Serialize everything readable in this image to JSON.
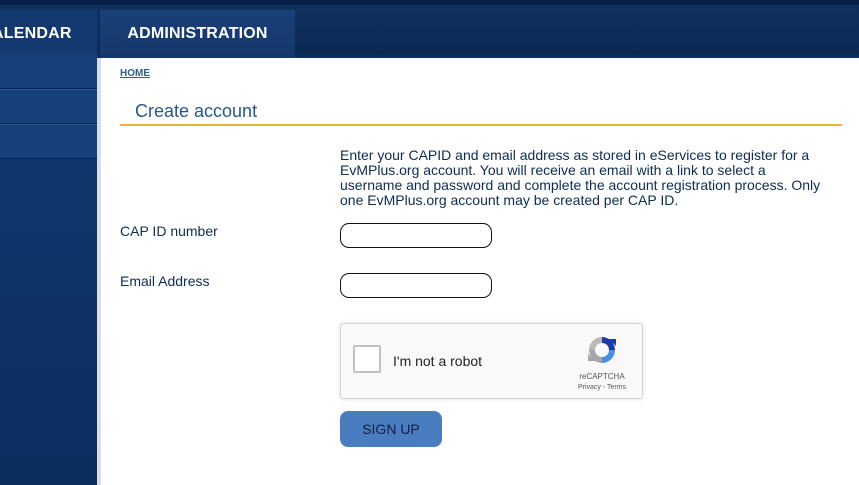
{
  "nav": {
    "tabs": [
      {
        "label": "ALENDAR"
      },
      {
        "label": "ADMINISTRATION"
      }
    ]
  },
  "breadcrumb": {
    "home": "HOME"
  },
  "page": {
    "title": "Create account",
    "intro": "Enter your CAPID and email address as stored in eServices to register for a EvMPlus.org account. You will receive an email with a link to select a username and password and complete the account registration process. Only one EvMPlus.org account may be created per CAP ID."
  },
  "form": {
    "capid_label": "CAP ID number",
    "capid_value": "",
    "email_label": "Email Address",
    "email_value": "",
    "submit_label": "SIGN UP"
  },
  "recaptcha": {
    "label": "I'm not a robot",
    "brand": "reCAPTCHA",
    "privacy": "Privacy",
    "separator": " - ",
    "terms": "Terms"
  },
  "colors": {
    "nav_bg": "#0d2a55",
    "accent_rule": "#e8b432",
    "title": "#24568f",
    "button": "#4a7dc0"
  }
}
